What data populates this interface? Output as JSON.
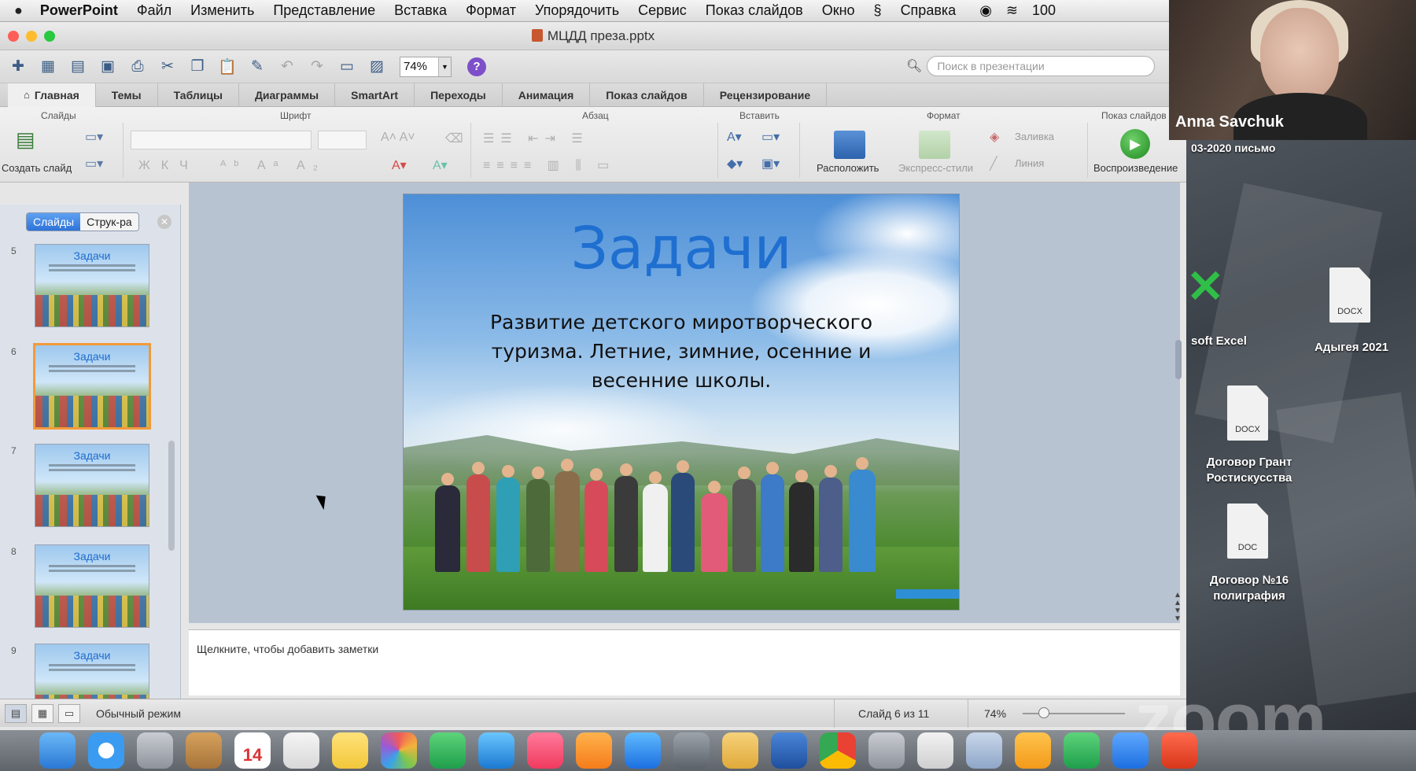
{
  "menubar": {
    "app": "PowerPoint",
    "items": [
      "Файл",
      "Изменить",
      "Представление",
      "Вставка",
      "Формат",
      "Упорядочить",
      "Сервис",
      "Показ слайдов",
      "Окно"
    ],
    "help": "Справка",
    "battery": "100"
  },
  "window": {
    "title": "МЦДД преза.pptx",
    "zoom": "74%",
    "search_placeholder": "Поиск в презентации"
  },
  "tabs": [
    "Главная",
    "Темы",
    "Таблицы",
    "Диаграммы",
    "SmartArt",
    "Переходы",
    "Анимация",
    "Показ слайдов",
    "Рецензирование"
  ],
  "ribbon": {
    "groups": {
      "slides": "Слайды",
      "font": "Шрифт",
      "paragraph": "Абзац",
      "insert": "Вставить",
      "format": "Формат",
      "slideshow": "Показ слайдов"
    },
    "new_slide": "Создать слайд",
    "arrange": "Расположить",
    "express_styles": "Экспресс-стили",
    "fill": "Заливка",
    "line": "Линия",
    "play": "Воспроизведение"
  },
  "leftpane": {
    "tab_slides": "Слайды",
    "tab_outline": "Струк-ра",
    "thumbnails": [
      {
        "num": "5",
        "title": "Задачи"
      },
      {
        "num": "6",
        "title": "Задачи"
      },
      {
        "num": "7",
        "title": "Задачи"
      },
      {
        "num": "8",
        "title": "Задачи"
      },
      {
        "num": "9",
        "title": "Задачи"
      }
    ]
  },
  "slide": {
    "title": "Задачи",
    "body": "Развитие детского миротворческого туризма. Летние, зимние, осенние и весенние школы."
  },
  "notes": {
    "placeholder": "Щелкните, чтобы добавить заметки"
  },
  "status": {
    "mode": "Обычный режим",
    "slide_count": "Слайд 6 из 11",
    "zoom": "74%"
  },
  "zoom_call": {
    "participant": "Anna Savchuk",
    "watermark": "zoom"
  },
  "desktop": {
    "header_snippet": "03-2020   письмо",
    "excel_label": "soft Excel",
    "files": [
      {
        "label": "Адыгея 2021",
        "type": "DOCX"
      },
      {
        "label": "Договор Грант Ростискусства",
        "type": "DOCX"
      },
      {
        "label": "Договор №16 полиграфия",
        "type": "DOC"
      }
    ]
  },
  "dock": {
    "calendar_day": "14"
  },
  "colors": {
    "accent": "#2e73d9",
    "slide_title": "#1f6fd1",
    "active_thumb": "#f29a3a",
    "play": "#1f8a21"
  }
}
